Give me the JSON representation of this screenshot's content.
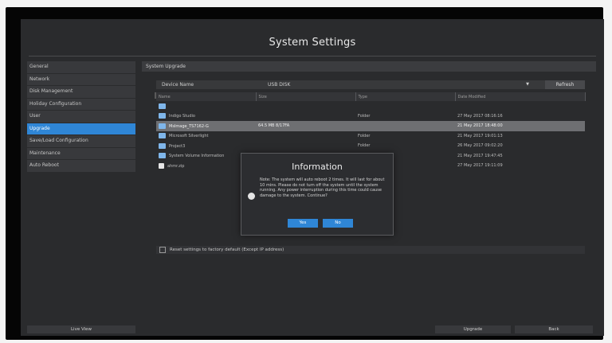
{
  "window": {
    "title": "System Settings"
  },
  "sidebar": {
    "items": [
      {
        "label": "General"
      },
      {
        "label": "Network"
      },
      {
        "label": "Disk Management"
      },
      {
        "label": "Holiday Configuration"
      },
      {
        "label": "User"
      },
      {
        "label": "Upgrade",
        "active": true
      },
      {
        "label": "Save/Load Configuration"
      },
      {
        "label": "Maintenance"
      },
      {
        "label": "Auto Reboot"
      }
    ]
  },
  "panel": {
    "header": "System Upgrade"
  },
  "device": {
    "label": "Device Name",
    "value": "USB DISK",
    "refresh_label": "Refresh"
  },
  "table": {
    "columns": [
      "Name",
      "Size",
      "Type",
      "Date Modified"
    ],
    "rows": [
      {
        "icon": "folder-icon",
        "name": "",
        "size": "",
        "type": "",
        "date": "",
        "selected": false
      },
      {
        "icon": "folder-icon",
        "name": "Indigo Studio",
        "size": "",
        "type": "Folder",
        "date": "27 May 2017 08:16:16",
        "selected": false
      },
      {
        "icon": "folder-icon",
        "name": "MsImage_TS7162-G",
        "size": "64.5 MB 8/17FA",
        "type": "",
        "date": "21 May 2017 18:48:00",
        "selected": true
      },
      {
        "icon": "folder-icon",
        "name": "Microsoft Silverlight",
        "size": "",
        "type": "Folder",
        "date": "21 May 2017 19:01:13",
        "selected": false
      },
      {
        "icon": "folder-icon",
        "name": "Project3",
        "size": "",
        "type": "Folder",
        "date": "26 May 2017 09:02:20",
        "selected": false
      },
      {
        "icon": "folder-icon",
        "name": "System Volume Information",
        "size": "",
        "type": "",
        "date": "21 May 2017 19:47:45",
        "selected": false
      },
      {
        "icon": "file-icon",
        "name": "ahmr.zip",
        "size": "",
        "type": "",
        "date": "27 May 2017 19:11:09",
        "selected": false
      }
    ]
  },
  "dialog": {
    "title": "Information",
    "message": "Note: The system will auto reboot 2 times. It will last for about 10 mins. Please do not turn off the system until the system running. Any power interruption during this time could cause damage to the system. Continue?",
    "yes_label": "Yes",
    "no_label": "No"
  },
  "reset": {
    "label": "Reset settings to factory default (Except IP address)",
    "checked": false
  },
  "footer": {
    "live_view_label": "Live View",
    "upgrade_label": "Upgrade",
    "back_label": "Back"
  }
}
